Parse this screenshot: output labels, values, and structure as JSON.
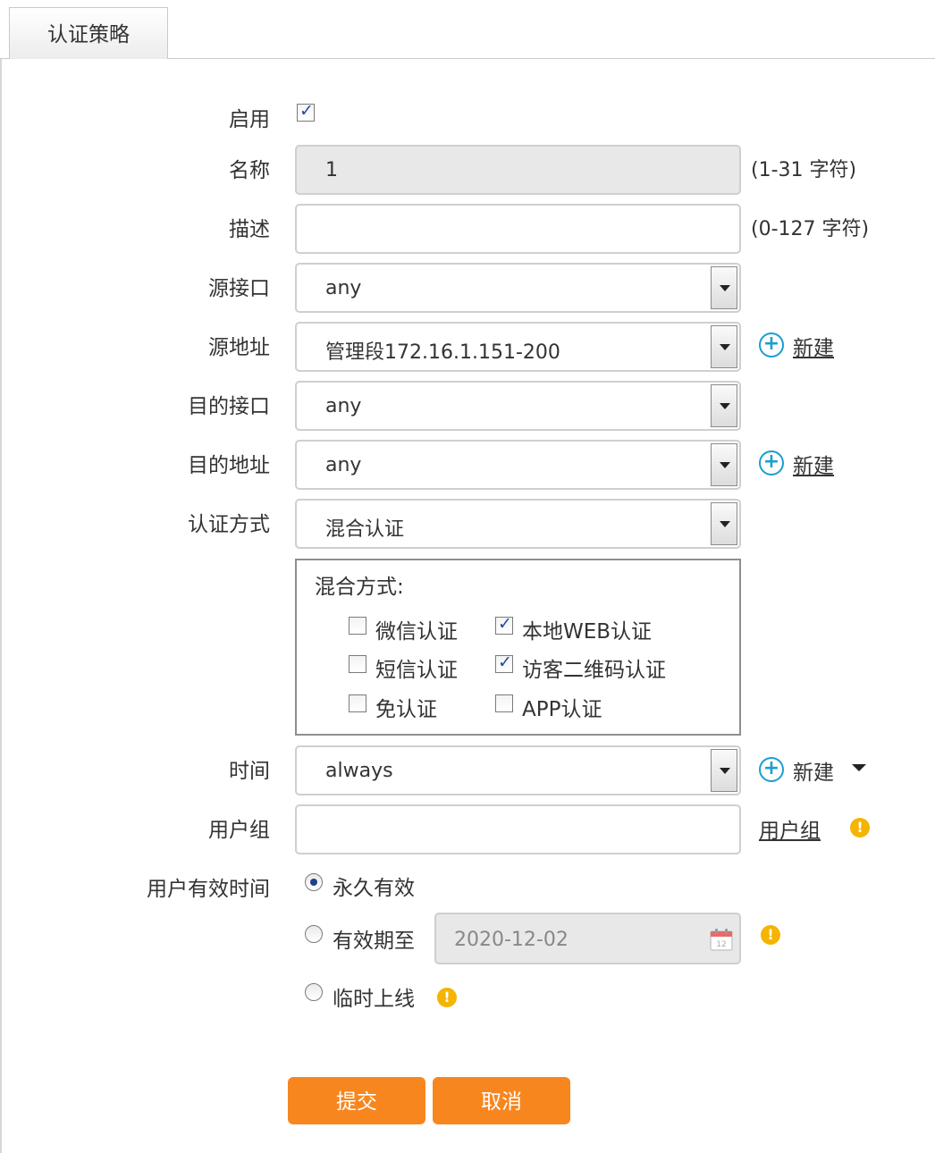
{
  "tab": {
    "title": "认证策略"
  },
  "form": {
    "enable": {
      "label": "启用",
      "checked": true
    },
    "name": {
      "label": "名称",
      "value": "1",
      "hint": "(1-31 字符)"
    },
    "description": {
      "label": "描述",
      "value": "",
      "hint": "(0-127 字符)"
    },
    "src_interface": {
      "label": "源接口",
      "value": "any"
    },
    "src_address": {
      "label": "源地址",
      "value": "管理段172.16.1.151-200",
      "new_label": "新建"
    },
    "dst_interface": {
      "label": "目的接口",
      "value": "any"
    },
    "dst_address": {
      "label": "目的地址",
      "value": "any",
      "new_label": "新建"
    },
    "auth_method": {
      "label": "认证方式",
      "value": "混合认证"
    },
    "mix": {
      "title": "混合方式:",
      "options": [
        {
          "label": "微信认证",
          "checked": false
        },
        {
          "label": "本地WEB认证",
          "checked": true
        },
        {
          "label": "短信认证",
          "checked": false
        },
        {
          "label": "访客二维码认证",
          "checked": true
        },
        {
          "label": "免认证",
          "checked": false
        },
        {
          "label": "APP认证",
          "checked": false
        }
      ]
    },
    "time": {
      "label": "时间",
      "value": "always",
      "new_label": "新建"
    },
    "user_group": {
      "label": "用户组",
      "value": "",
      "link": "用户组"
    },
    "validity": {
      "label": "用户有效时间",
      "options": [
        {
          "label": "永久有效",
          "checked": true
        },
        {
          "label": "有效期至",
          "checked": false
        },
        {
          "label": "临时上线",
          "checked": false
        }
      ],
      "date": "2020-12-02",
      "calendar_day": "12"
    }
  },
  "buttons": {
    "submit": "提交",
    "cancel": "取消"
  },
  "icons": {
    "plus": "plus-circle-icon",
    "warning": "warning-icon",
    "calendar": "calendar-icon",
    "caret": "caret-down-icon"
  },
  "colors": {
    "accent": "#f8861f",
    "link_icon": "#1a9fd0",
    "warning": "#f4b400"
  }
}
